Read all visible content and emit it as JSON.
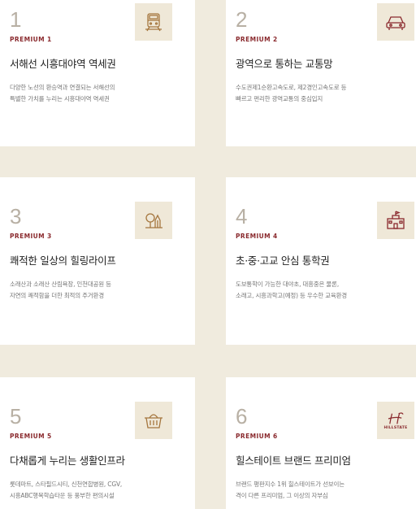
{
  "cards": [
    {
      "num": "1",
      "premium": "PREMIUM 1",
      "title": "서해선 시흥대야역 역세권",
      "desc": "다양한 노선의 환승역과 연결되는 서해선의\n특별한 가치를 누리는 시흥대야역 역세권",
      "icon": "train-icon"
    },
    {
      "num": "2",
      "premium": "PREMIUM 2",
      "title": "광역으로 통하는 교통망",
      "desc": "수도권제1순환고속도로, 제2경인고속도로 등\n빠르고 편리한 광역교통의 중심입지",
      "icon": "car-icon"
    },
    {
      "num": "3",
      "premium": "PREMIUM 3",
      "title": "쾌적한 일상의 힐링라이프",
      "desc": "소래산과 소래산 산림욕장, 인천대공원 등\n자연의 쾌적함을 더한 최적의 주거환경",
      "icon": "tree-icon"
    },
    {
      "num": "4",
      "premium": "PREMIUM 4",
      "title": "초·중·고교 안심 통학권",
      "desc": "도보통학이 가능한 대야초, 대흥중은 물론,\n소래고, 시흥과학고(예정) 등 우수한 교육환경",
      "icon": "school-icon"
    },
    {
      "num": "5",
      "premium": "PREMIUM 5",
      "title": "다채롭게 누리는 생활인프라",
      "desc": "롯데마트, 스타필드시티, 신천연합병원, CGV,\n시흥ABC행복학습타운 등 풍부한 편의시설",
      "icon": "basket-icon"
    },
    {
      "num": "6",
      "premium": "PREMIUM 6",
      "title": "힐스테이트 브랜드 프리미엄",
      "desc": "브랜드 평판지수 1위 힐스테이트가 선보이는\n격이 다른 프리미엄, 그 이상의 자부심",
      "icon": "hillstate-logo-icon",
      "logo_text": "HILLSTATE"
    }
  ],
  "colors": {
    "background": "#f0ebde",
    "accent": "#8a2a2e",
    "icon_color": "#a5763e",
    "badge_bg": "#efe8d8"
  }
}
